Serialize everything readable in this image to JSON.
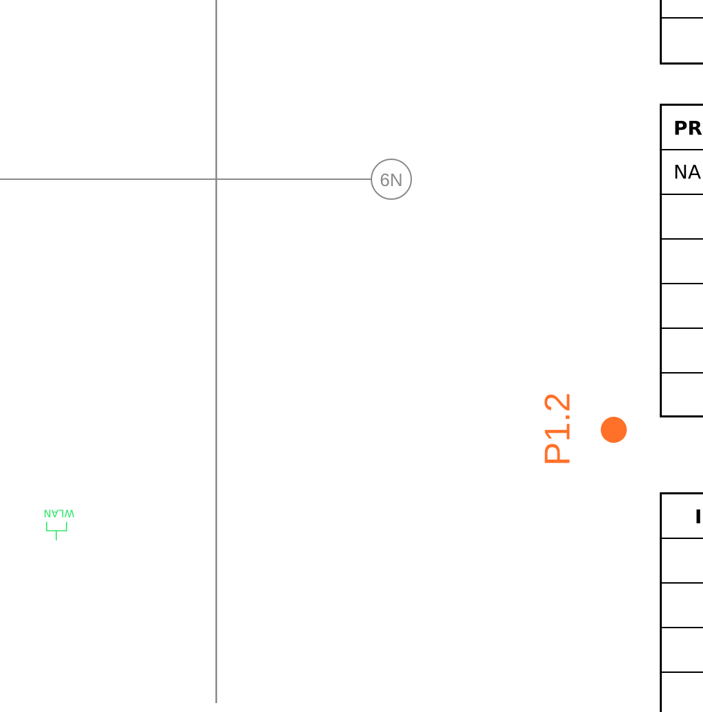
{
  "colors": {
    "background": "#ffffff",
    "grid_line": "#888888",
    "grid_bubble": "#8a8a8a",
    "point_marker": "#ff7028",
    "wlan_symbol": "#2ee66a",
    "table_border": "#000000"
  },
  "grid": {
    "bubble_label": "N9"
  },
  "point": {
    "label": "P1.2"
  },
  "wlan": {
    "label": "WLAN",
    "icon": "wlan-access-point-icon"
  },
  "title_block": {
    "header_label": "PRU",
    "name_label": "NA"
  },
  "info_table": {
    "header_label": "II"
  }
}
